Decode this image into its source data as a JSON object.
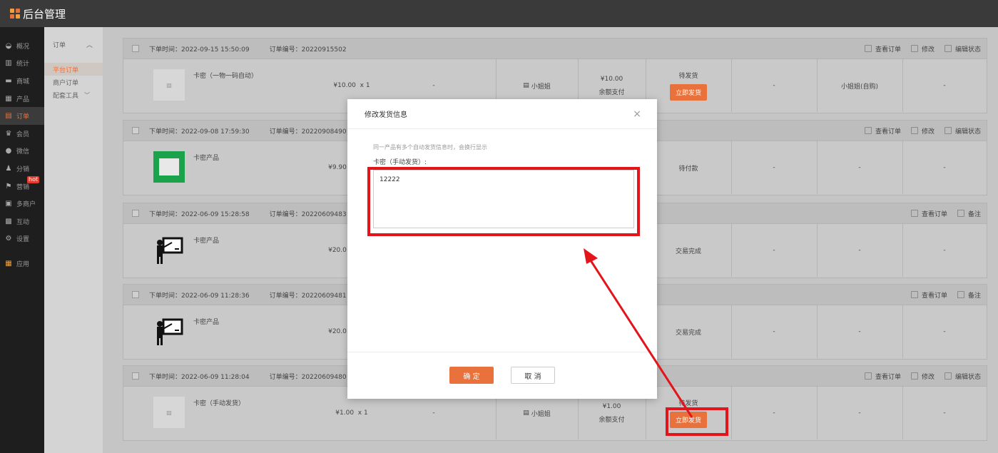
{
  "app": {
    "title": "后台管理"
  },
  "colors": {
    "accent": "#e8713c",
    "highlight": "#e3151b",
    "hot": "#e23b2e"
  },
  "sidebar": {
    "items": [
      {
        "label": "概况",
        "icon": "dashboard-icon"
      },
      {
        "label": "统计",
        "icon": "stats-icon"
      },
      {
        "label": "商城",
        "icon": "store-icon"
      },
      {
        "label": "产品",
        "icon": "grid-icon"
      },
      {
        "label": "订单",
        "icon": "order-icon",
        "active": true
      },
      {
        "label": "会员",
        "icon": "crown-icon"
      },
      {
        "label": "微信",
        "icon": "wechat-icon"
      },
      {
        "label": "分销",
        "icon": "users-icon"
      },
      {
        "label": "营销",
        "icon": "flag-icon",
        "badge": "hot"
      },
      {
        "label": "多商户",
        "icon": "shop-icon"
      },
      {
        "label": "互动",
        "icon": "interact-icon"
      },
      {
        "label": "设置",
        "icon": "gear-icon"
      },
      {
        "label": "应用",
        "icon": "apps-icon"
      }
    ]
  },
  "submenu": {
    "group": "订单",
    "items": [
      "平台订单",
      "商户订单"
    ],
    "tools": "配套工具"
  },
  "orders": [
    {
      "time": "下单时间：2022-09-15 15:50:09",
      "no": "订单编号：20220915502",
      "product": "卡密（一物一码自动）",
      "price": "¥10.00",
      "qty": "x 1",
      "dash1": "-",
      "buyer": "小姐姐",
      "total": "¥10.00",
      "pay": "余额支付",
      "status": "待发货",
      "ship": "立即发货",
      "c1": "-",
      "c2": "小姐姐(自购)",
      "c3": "-",
      "actions": [
        "查看订单",
        "修改",
        "编辑状态"
      ]
    },
    {
      "time": "下单时间：2022-09-08 17:59:30",
      "no": "订单编号：20220908490",
      "product": "卡密产品",
      "price": "¥9.90",
      "status": "待付款",
      "c1": "-",
      "c2": "-",
      "c3": "-",
      "actions": [
        "查看订单",
        "修改",
        "编辑状态"
      ]
    },
    {
      "time": "下单时间：2022-06-09 15:28:58",
      "no": "订单编号：20220609483",
      "product": "卡密产品",
      "price": "¥20.0",
      "status": "交易完成",
      "c1": "-",
      "c2": "-",
      "c3": "-",
      "actions": [
        "查看订单",
        "备注"
      ]
    },
    {
      "time": "下单时间：2022-06-09 11:28:36",
      "no": "订单编号：20220609481",
      "product": "卡密产品",
      "price": "¥20.0",
      "status": "交易完成",
      "c1": "-",
      "c2": "-",
      "c3": "-",
      "actions": [
        "查看订单",
        "备注"
      ]
    },
    {
      "time": "下单时间：2022-06-09 11:28:04",
      "no": "订单编号：20220609480",
      "product": "卡密（手动发货）",
      "price": "¥1.00",
      "qty": "x 1",
      "dash1": "-",
      "buyer": "小姐姐",
      "total": "¥1.00",
      "pay": "余额支付",
      "status": "待发货",
      "ship": "立即发货",
      "c1": "-",
      "c2": "-",
      "c3": "-",
      "actions": [
        "查看订单",
        "修改",
        "编辑状态"
      ]
    }
  ],
  "modal": {
    "title": "修改发货信息",
    "close": "×",
    "hint": "同一产品有多个自动发货信息时，会换行显示",
    "field_label": "卡密（手动发货）:",
    "value": "12222",
    "ok": "确 定",
    "cancel": "取 消"
  }
}
